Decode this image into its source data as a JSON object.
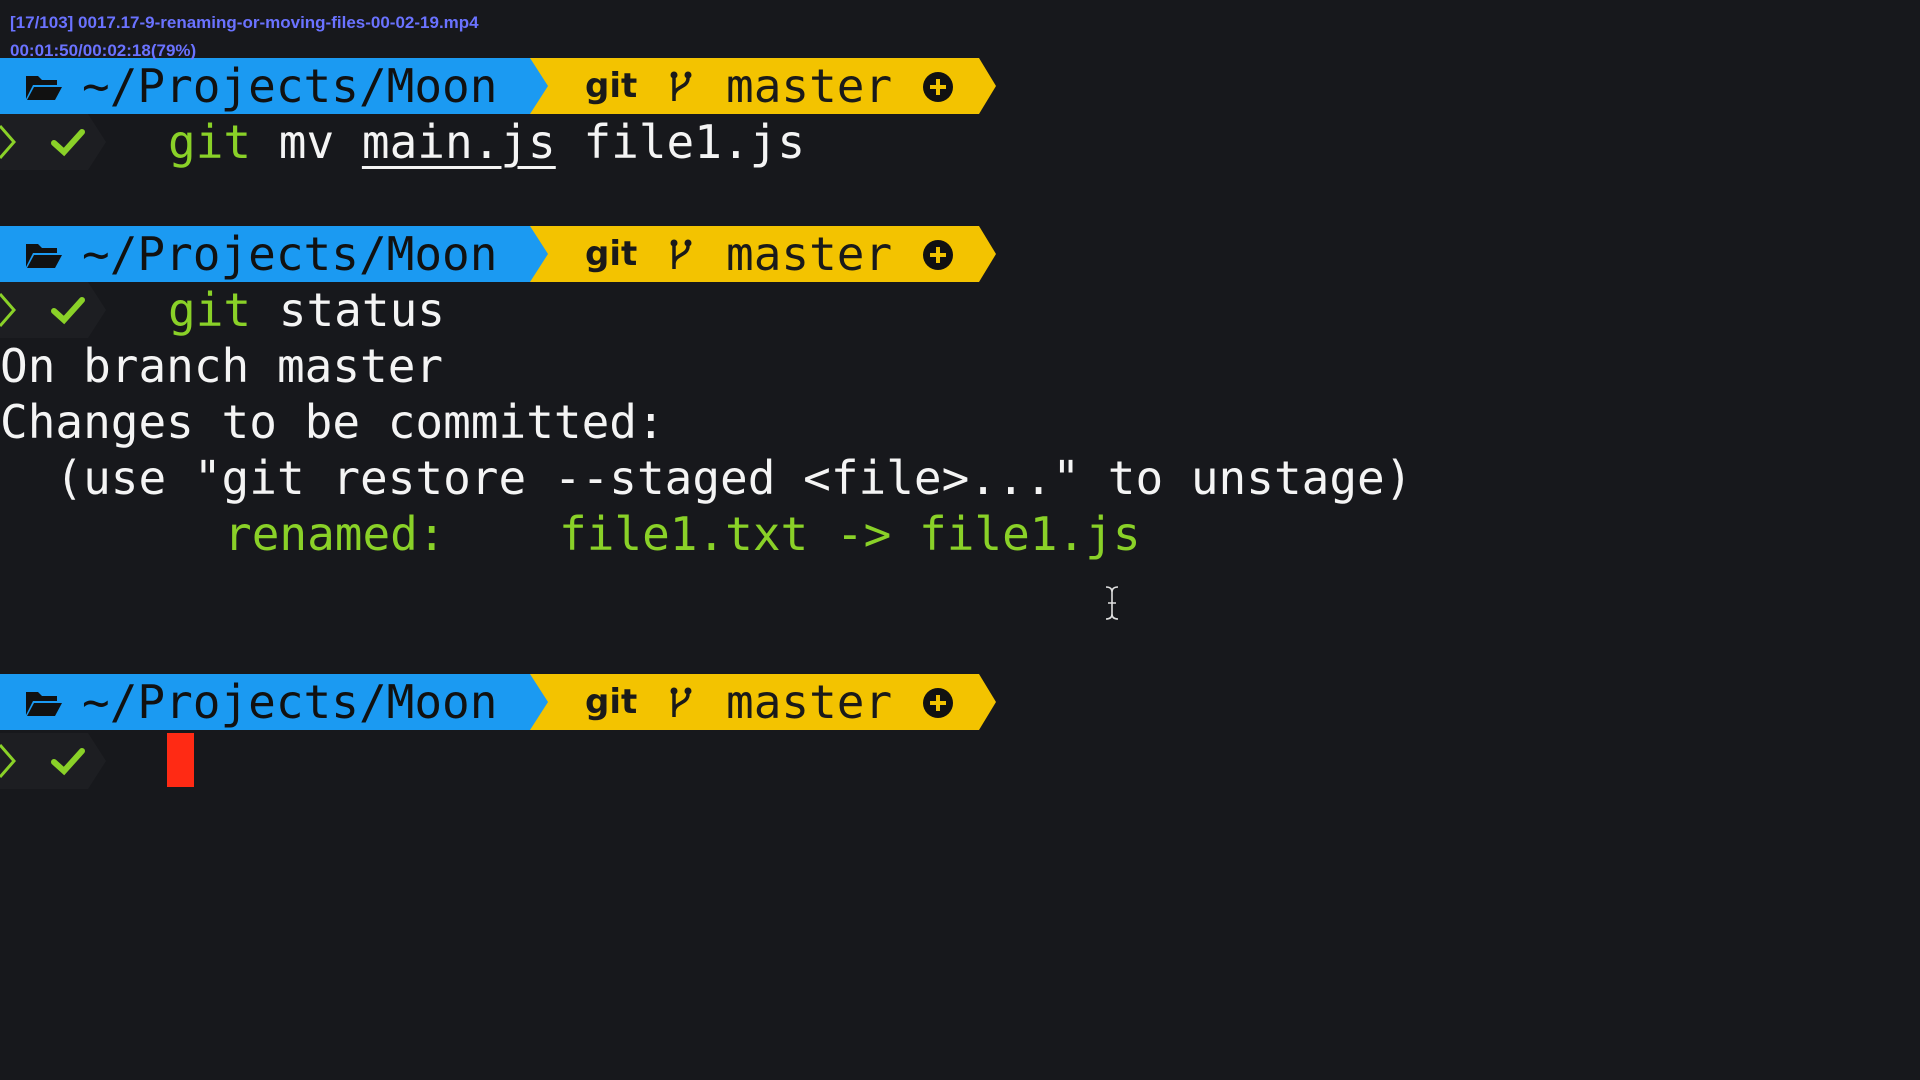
{
  "video_overlay": {
    "title_line": "[17/103] 0017.17-9-renaming-or-moving-files-00-02-19.mp4",
    "time_line": "00:01:50/00:02:18(79%)"
  },
  "prompt": {
    "path": "~/Projects/Moon",
    "git_label": "git",
    "branch": "master",
    "icons": [
      "folder-open-icon",
      "git-branch-icon",
      "plus-circle-icon",
      "chevron-right-icon",
      "check-icon"
    ]
  },
  "commands": {
    "first": {
      "git": "git",
      "sub": "mv",
      "arg1": "main.js",
      "arg2": "file1.js"
    },
    "second": {
      "git": "git",
      "sub": "status"
    }
  },
  "output": {
    "line1": "On branch master",
    "line2": "Changes to be committed:",
    "line3": "  (use \"git restore --staged <file>...\" to unstage)",
    "renamed_label": "renamed:",
    "renamed_value": "file1.txt -> file1.js"
  },
  "colors": {
    "background": "#17181c",
    "path_segment": "#1b9af2",
    "git_segment": "#f3c300",
    "green": "#8ad128",
    "cursor": "#ff2a14"
  }
}
